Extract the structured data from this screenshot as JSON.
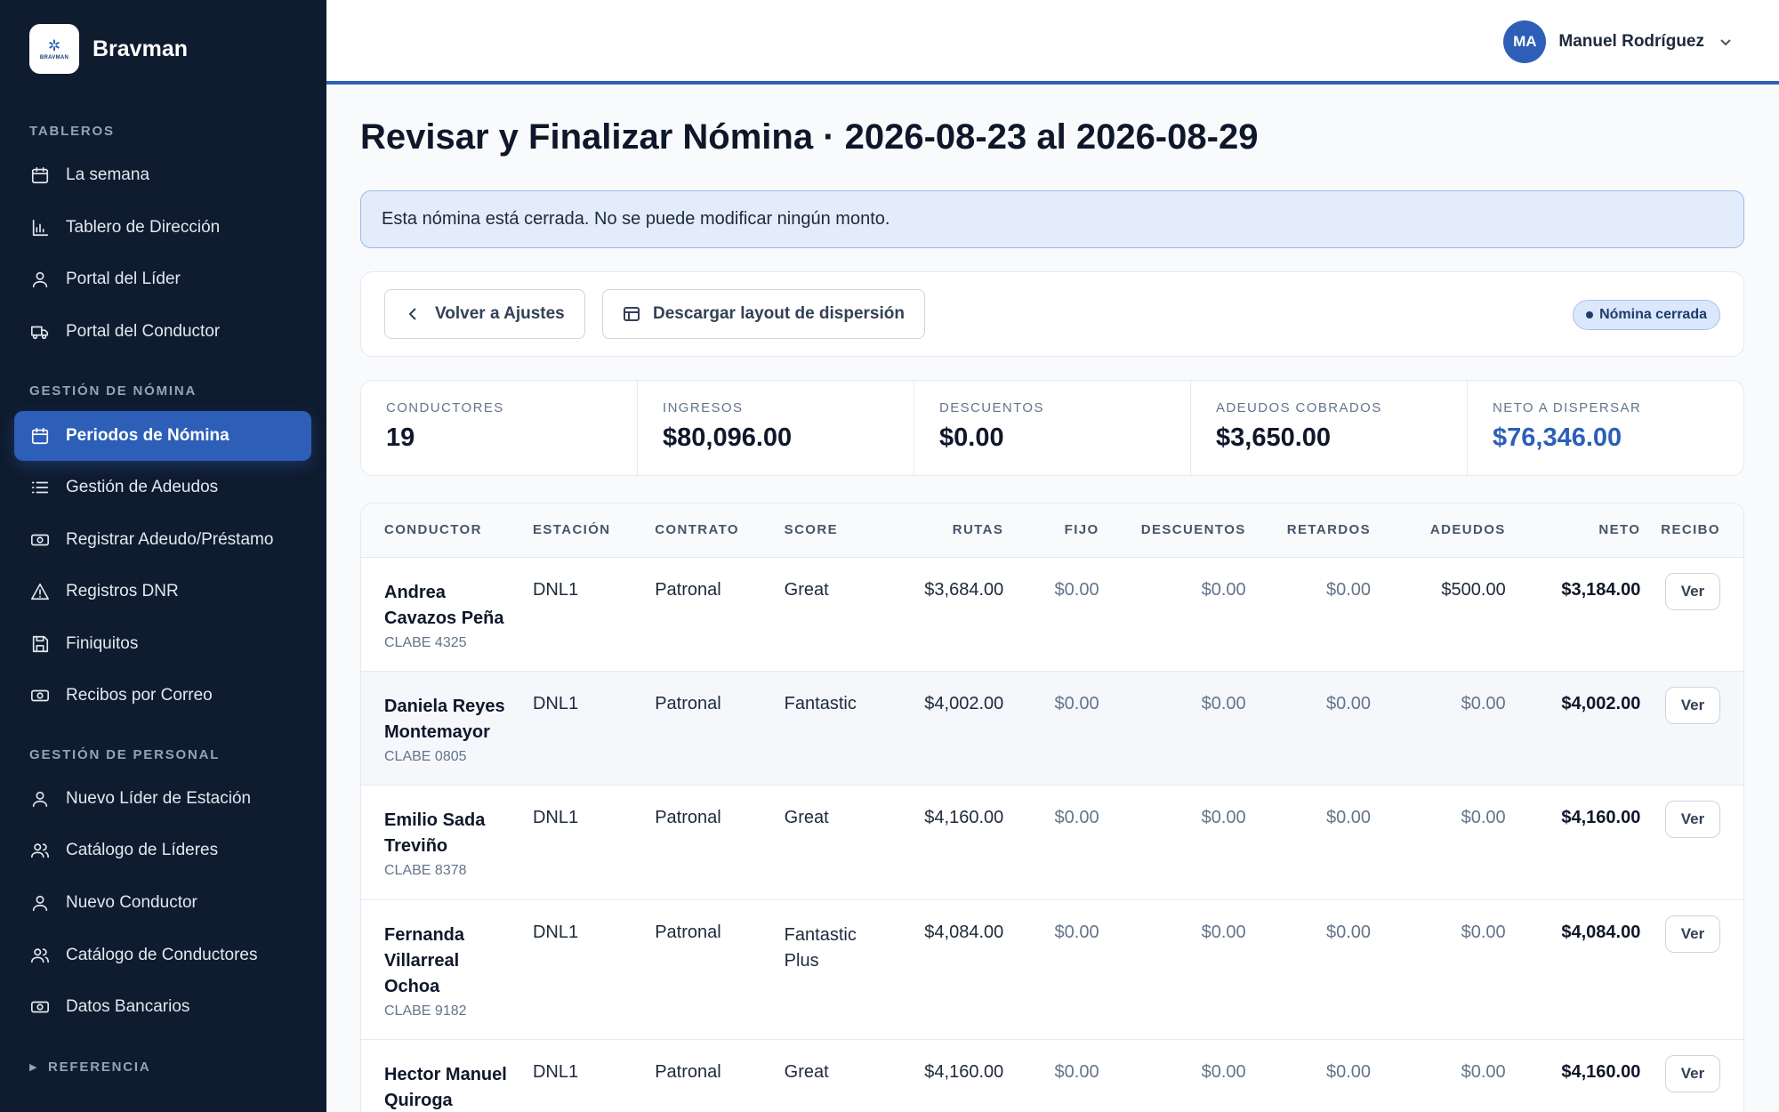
{
  "brand": {
    "name": "Bravman",
    "logo_text": "BRAVMAN"
  },
  "sidebar": {
    "sections": [
      {
        "title": "TABLEROS",
        "items": [
          {
            "label": "La semana",
            "icon": "calendar-icon"
          },
          {
            "label": "Tablero de Dirección",
            "icon": "bar-chart-icon"
          },
          {
            "label": "Portal del Líder",
            "icon": "user-icon"
          },
          {
            "label": "Portal del Conductor",
            "icon": "truck-icon"
          }
        ]
      },
      {
        "title": "GESTIÓN DE NÓMINA",
        "items": [
          {
            "label": "Periodos de Nómina",
            "icon": "calendar-icon",
            "active": true
          },
          {
            "label": "Gestión de Adeudos",
            "icon": "list-icon"
          },
          {
            "label": "Registrar Adeudo/Préstamo",
            "icon": "cash-icon"
          },
          {
            "label": "Registros DNR",
            "icon": "warning-icon"
          },
          {
            "label": "Finiquitos",
            "icon": "save-icon"
          },
          {
            "label": "Recibos por Correo",
            "icon": "cash-icon"
          }
        ]
      },
      {
        "title": "GESTIÓN DE PERSONAL",
        "items": [
          {
            "label": "Nuevo Líder de Estación",
            "icon": "user-icon"
          },
          {
            "label": "Catálogo de Líderes",
            "icon": "users-icon"
          },
          {
            "label": "Nuevo Conductor",
            "icon": "user-icon"
          },
          {
            "label": "Catálogo de Conductores",
            "icon": "users-icon"
          },
          {
            "label": "Datos Bancarios",
            "icon": "cash-icon"
          }
        ]
      }
    ],
    "reference": {
      "title": "REFERENCIA"
    }
  },
  "topbar": {
    "user": {
      "initials": "MA",
      "name": "Manuel Rodríguez"
    }
  },
  "page": {
    "title": "Revisar y Finalizar Nómina · 2026-08-23 al 2026-08-29",
    "banner": "Esta nómina está cerrada. No se puede modificar ningún monto."
  },
  "actions": {
    "back_label": "Volver a Ajustes",
    "download_label": "Descargar layout de dispersión",
    "status_badge": "Nómina cerrada"
  },
  "stats": [
    {
      "label": "CONDUCTORES",
      "value": "19"
    },
    {
      "label": "INGRESOS",
      "value": "$80,096.00"
    },
    {
      "label": "DESCUENTOS",
      "value": "$0.00"
    },
    {
      "label": "ADEUDOS COBRADOS",
      "value": "$3,650.00"
    },
    {
      "label": "NETO A DISPERSAR",
      "value": "$76,346.00",
      "accent": true
    }
  ],
  "table": {
    "columns": [
      "CONDUCTOR",
      "ESTACIÓN",
      "CONTRATO",
      "SCORE",
      "RUTAS",
      "FIJO",
      "DESCUENTOS",
      "RETARDOS",
      "ADEUDOS",
      "NETO",
      "RECIBO"
    ],
    "rows": [
      {
        "name_lines": [
          "Andrea",
          "Cavazos Peña"
        ],
        "clabe": "CLABE 4325",
        "station": "DNL1",
        "contract": "Patronal",
        "score": "Great",
        "rutas": "$3,684.00",
        "fijo": "$0.00",
        "descuentos": "$0.00",
        "retardos": "$0.00",
        "adeudos": "$500.00",
        "neto": "$3,184.00",
        "recibo": "Ver"
      },
      {
        "name_lines": [
          "Daniela Reyes",
          "Montemayor"
        ],
        "clabe": "CLABE 0805",
        "station": "DNL1",
        "contract": "Patronal",
        "score": "Fantastic",
        "rutas": "$4,002.00",
        "fijo": "$0.00",
        "descuentos": "$0.00",
        "retardos": "$0.00",
        "adeudos": "$0.00",
        "neto": "$4,002.00",
        "recibo": "Ver"
      },
      {
        "name_lines": [
          "Emilio Sada",
          "Treviño"
        ],
        "clabe": "CLABE 8378",
        "station": "DNL1",
        "contract": "Patronal",
        "score": "Great",
        "rutas": "$4,160.00",
        "fijo": "$0.00",
        "descuentos": "$0.00",
        "retardos": "$0.00",
        "adeudos": "$0.00",
        "neto": "$4,160.00",
        "recibo": "Ver"
      },
      {
        "name_lines": [
          "Fernanda",
          "Villarreal",
          "Ochoa"
        ],
        "clabe": "CLABE 9182",
        "station": "DNL1",
        "contract": "Patronal",
        "score": "Fantastic Plus",
        "rutas": "$4,084.00",
        "fijo": "$0.00",
        "descuentos": "$0.00",
        "retardos": "$0.00",
        "adeudos": "$0.00",
        "neto": "$4,084.00",
        "recibo": "Ver"
      },
      {
        "name_lines": [
          "Hector Manuel",
          "Quiroga"
        ],
        "clabe": "",
        "station": "DNL1",
        "contract": "Patronal",
        "score": "Great",
        "rutas": "$4,160.00",
        "fijo": "$0.00",
        "descuentos": "$0.00",
        "retardos": "$0.00",
        "adeudos": "$0.00",
        "neto": "$4,160.00",
        "recibo": "Ver"
      }
    ]
  },
  "colors": {
    "sidebar_bg": "#0f1b2e",
    "accent": "#2d5fb8",
    "banner_bg": "#e3ecfb"
  }
}
